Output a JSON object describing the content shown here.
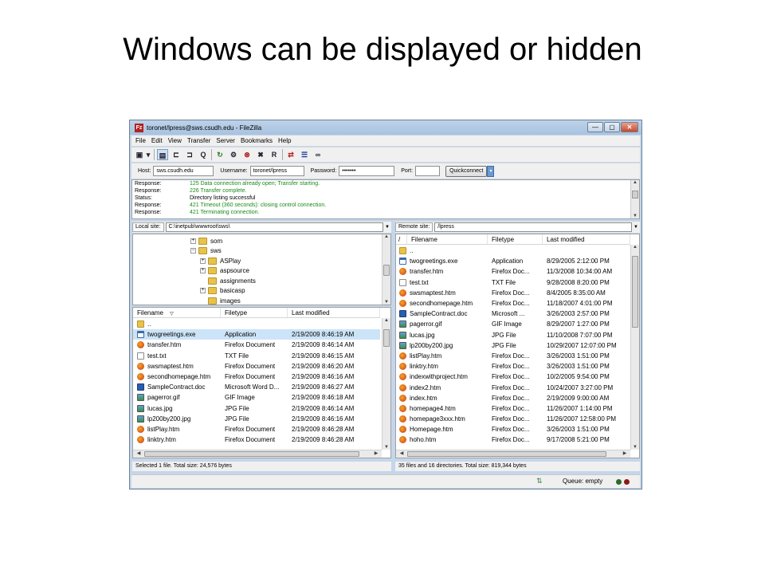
{
  "slide": {
    "title": "Windows can be displayed or hidden"
  },
  "window": {
    "title": "toronet/lpress@sws.csudh.edu - FileZilla",
    "app_icon": "Fz",
    "controls": {
      "minimize": "—",
      "maximize": "▢",
      "close": "✕"
    }
  },
  "menu": [
    "File",
    "Edit",
    "View",
    "Transfer",
    "Server",
    "Bookmarks",
    "Help"
  ],
  "toolbar": {
    "icons": [
      "site-manager-icon",
      "dropdown-arrow-icon",
      "toggle-message-log-icon",
      "toggle-local-tree-icon",
      "toggle-remote-tree-icon",
      "toggle-queue-icon",
      "refresh-icon",
      "process-queue-icon",
      "cancel-icon",
      "disconnect-icon",
      "reconnect-icon",
      "compare-icon",
      "sync-browse-icon",
      "binoculars-icon"
    ],
    "glyphs": [
      "▣",
      "▾",
      "▤",
      "⊏",
      "⊐",
      "Q",
      "↻",
      "⚙",
      "⊗",
      "✖",
      "R",
      "⇄",
      "☰",
      "∞"
    ]
  },
  "quickconnect": {
    "host_label": "Host:",
    "host_value": "sws.csudh.edu",
    "username_label": "Username:",
    "username_value": "toronet/lpress",
    "password_label": "Password:",
    "password_value": "•••••••",
    "port_label": "Port:",
    "port_value": "",
    "button": "Quickconnect",
    "dropdown": "▾"
  },
  "log": [
    {
      "type": "Response:",
      "text": "125 Data connection already open; Transfer starting.",
      "neutral": false
    },
    {
      "type": "Response:",
      "text": "226 Transfer complete.",
      "neutral": false
    },
    {
      "type": "Status:",
      "text": "Directory listing successful",
      "neutral": true
    },
    {
      "type": "Response:",
      "text": "421 Timeout (360 seconds): closing control connection.",
      "neutral": false
    },
    {
      "type": "Response:",
      "text": "421 Terminating connection.",
      "neutral": false
    }
  ],
  "local": {
    "site_label": "Local site:",
    "site_path": "C:\\inetpub\\wwwroot\\sws\\",
    "tree": [
      {
        "name": "som",
        "expander": "+"
      },
      {
        "name": "sws",
        "expander": "−"
      },
      {
        "name": "ASPlay",
        "expander": "+"
      },
      {
        "name": "aspsource",
        "expander": "+"
      },
      {
        "name": "assignments",
        "expander": ""
      },
      {
        "name": "basicasp",
        "expander": "+"
      },
      {
        "name": "images",
        "expander": ""
      }
    ],
    "columns": {
      "name": "Filename",
      "sort_indicator": "▽",
      "type": "Filetype",
      "modified": "Last modified"
    },
    "files": [
      {
        "name": "..",
        "type": "",
        "modified": "",
        "icon": "folder"
      },
      {
        "name": "twogreetings.exe",
        "type": "Application",
        "modified": "2/19/2009 8:46:19 AM",
        "icon": "exe"
      },
      {
        "name": "transfer.htm",
        "type": "Firefox Document",
        "modified": "2/19/2009 8:46:14 AM",
        "icon": "ff"
      },
      {
        "name": "test.txt",
        "type": "TXT File",
        "modified": "2/19/2009 8:46:15 AM",
        "icon": "doc"
      },
      {
        "name": "swsmaptest.htm",
        "type": "Firefox Document",
        "modified": "2/19/2009 8:46:20 AM",
        "icon": "ff"
      },
      {
        "name": "secondhomepage.htm",
        "type": "Firefox Document",
        "modified": "2/19/2009 8:46:16 AM",
        "icon": "ff"
      },
      {
        "name": "SampleContract.doc",
        "type": "Microsoft Word D...",
        "modified": "2/19/2009 8:46:27 AM",
        "icon": "word"
      },
      {
        "name": "pagerror.gif",
        "type": "GIF Image",
        "modified": "2/19/2009 8:46:18 AM",
        "icon": "img"
      },
      {
        "name": "lucas.jpg",
        "type": "JPG File",
        "modified": "2/19/2009 8:46:14 AM",
        "icon": "img"
      },
      {
        "name": "lp200by200.jpg",
        "type": "JPG File",
        "modified": "2/19/2009 8:46:16 AM",
        "icon": "img"
      },
      {
        "name": "listPlay.htm",
        "type": "Firefox Document",
        "modified": "2/19/2009 8:46:28 AM",
        "icon": "ff"
      },
      {
        "name": "linktry.htm",
        "type": "Firefox Document",
        "modified": "2/19/2009 8:46:28 AM",
        "icon": "ff"
      }
    ],
    "status": "Selected 1 file. Total size: 24,576 bytes"
  },
  "remote": {
    "site_label": "Remote site:",
    "site_path": "/lpress",
    "tree_root": "/",
    "columns": {
      "name": "Filename",
      "type": "Filetype",
      "modified": "Last modified"
    },
    "files": [
      {
        "name": "..",
        "type": "",
        "modified": "",
        "icon": "folder"
      },
      {
        "name": "twogreetings.exe",
        "type": "Application",
        "modified": "8/29/2005 2:12:00 PM",
        "icon": "exe"
      },
      {
        "name": "transfer.htm",
        "type": "Firefox Doc...",
        "modified": "11/3/2008 10:34:00 AM",
        "icon": "ff"
      },
      {
        "name": "test.txt",
        "type": "TXT File",
        "modified": "9/28/2008 8:20:00 PM",
        "icon": "doc"
      },
      {
        "name": "swsmaptest.htm",
        "type": "Firefox Doc...",
        "modified": "8/4/2005 8:35:00 AM",
        "icon": "ff"
      },
      {
        "name": "secondhomepage.htm",
        "type": "Firefox Doc...",
        "modified": "11/18/2007 4:01:00 PM",
        "icon": "ff"
      },
      {
        "name": "SampleContract.doc",
        "type": "Microsoft ...",
        "modified": "3/26/2003 2:57:00 PM",
        "icon": "word"
      },
      {
        "name": "pagerror.gif",
        "type": "GIF Image",
        "modified": "8/29/2007 1:27:00 PM",
        "icon": "img"
      },
      {
        "name": "lucas.jpg",
        "type": "JPG File",
        "modified": "11/10/2008 7:07:00 PM",
        "icon": "img"
      },
      {
        "name": "lp200by200.jpg",
        "type": "JPG File",
        "modified": "10/29/2007 12:07:00 PM",
        "icon": "img"
      },
      {
        "name": "listPlay.htm",
        "type": "Firefox Doc...",
        "modified": "3/26/2003 1:51:00 PM",
        "icon": "ff"
      },
      {
        "name": "linktry.htm",
        "type": "Firefox Doc...",
        "modified": "3/26/2003 1:51:00 PM",
        "icon": "ff"
      },
      {
        "name": "indexwithproject.htm",
        "type": "Firefox Doc...",
        "modified": "10/2/2005 9:54:00 PM",
        "icon": "ff"
      },
      {
        "name": "index2.htm",
        "type": "Firefox Doc...",
        "modified": "10/24/2007 3:27:00 PM",
        "icon": "ff"
      },
      {
        "name": "index.htm",
        "type": "Firefox Doc...",
        "modified": "2/19/2009 9:00:00 AM",
        "icon": "ff"
      },
      {
        "name": "homepage4.htm",
        "type": "Firefox Doc...",
        "modified": "11/26/2007 1:14:00 PM",
        "icon": "ff"
      },
      {
        "name": "homepage3xxx.htm",
        "type": "Firefox Doc...",
        "modified": "11/26/2007 12:58:00 PM",
        "icon": "ff"
      },
      {
        "name": "Homepage.htm",
        "type": "Firefox Doc...",
        "modified": "3/26/2003 1:51:00 PM",
        "icon": "ff"
      },
      {
        "name": "hoho.htm",
        "type": "Firefox Doc...",
        "modified": "9/17/2008 5:21:00 PM",
        "icon": "ff"
      }
    ],
    "status": "35 files and 16 directories. Total size: 819,344 bytes"
  },
  "scroll": {
    "up": "▲",
    "down": "▼",
    "left": "◀",
    "right": "▶"
  },
  "queue": {
    "icon": "⇅",
    "text": "Queue: empty"
  }
}
